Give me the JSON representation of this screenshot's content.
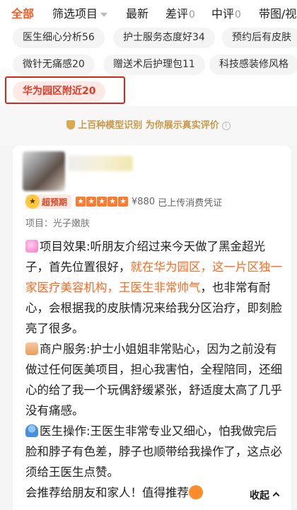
{
  "tabs": [
    {
      "label": "全部",
      "count": ""
    },
    {
      "label": "筛选项目",
      "count": ""
    },
    {
      "label": "最新",
      "count": ""
    },
    {
      "label": "差评",
      "count": "0"
    },
    {
      "label": "中评",
      "count": "0"
    },
    {
      "label": "带图/视",
      "count": ""
    }
  ],
  "chips": [
    {
      "label": "医生细心分析56"
    },
    {
      "label": "护士服务态度好34"
    },
    {
      "label": "预约后有皮肤"
    },
    {
      "label": "微针无痛感20"
    },
    {
      "label": "赠送术后护理包11"
    },
    {
      "label": "科技感装修风格"
    },
    {
      "label": "华为园区附近20"
    }
  ],
  "banner": {
    "text": "上百种模型识别 为你展示真实评价"
  },
  "review": {
    "badge": "超预期",
    "price": "¥880",
    "voucher": "已上传消费凭证",
    "project": "项目：光子嫩肤",
    "effect_a": "项目效果:听朋友介绍过来今天做了黑金超光子，首先位置很好，",
    "effect_hl": "就在华为园区，这一片区独一家医疗美容机构，王医生非常帅气",
    "effect_b": "，也非常有耐心，会根据我的皮肤情况来给我分区治疗，即刻脸亮了很多。",
    "service": "商户服务:护士小姐姐非常贴心，因为之前没有做过任何医美项目，担心我害怕，全程陪同，还细心的给了我一个玩偶舒缓紧张，舒适度太高了几乎没有痛感。",
    "doctor": "医生操作:王医生非常专业又细心，怕我做完后脸和脖子有色差，脖子也顺带给我操作了，这点必须给王医生点赞。",
    "closing": "会推荐给朋友和家人！值得推荐",
    "collapse": "收起"
  }
}
